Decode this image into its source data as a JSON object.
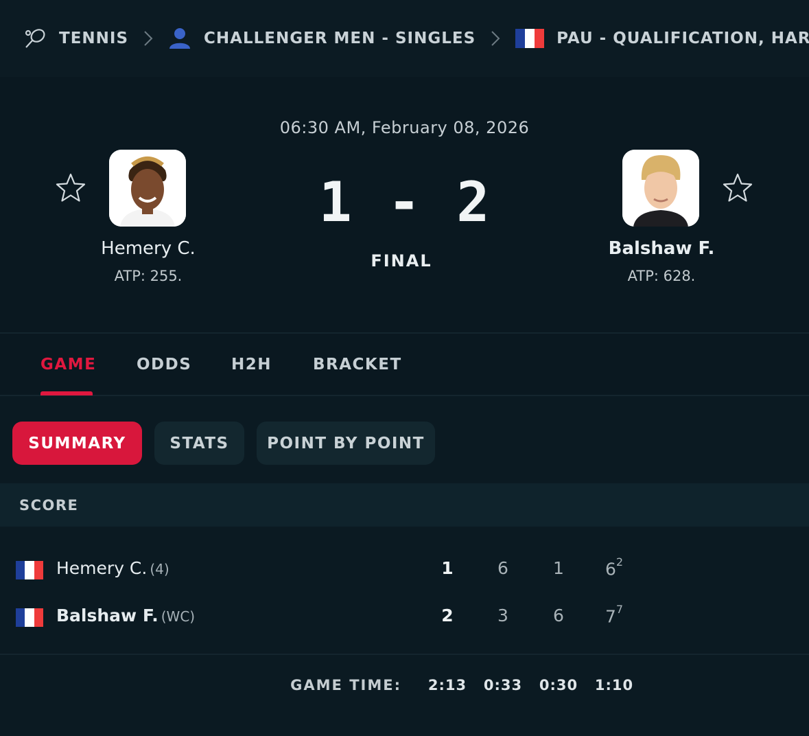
{
  "breadcrumb": {
    "sport": "TENNIS",
    "category": "CHALLENGER MEN - SINGLES",
    "tournament": "PAU - QUALIFICATION, HARD -"
  },
  "match": {
    "datetime": "06:30 AM, February 08, 2026",
    "score": "1-2",
    "status": "FINAL",
    "home": {
      "name": "Hemery C.",
      "rank": "ATP: 255."
    },
    "away": {
      "name": "Balshaw F.",
      "rank": "ATP: 628."
    }
  },
  "tabs": [
    "GAME",
    "ODDS",
    "H2H",
    "BRACKET"
  ],
  "subtabs": [
    "SUMMARY",
    "STATS",
    "POINT BY POINT"
  ],
  "score_table": {
    "header": "SCORE",
    "rows": [
      {
        "name": "Hemery C.",
        "seed": "(4)",
        "sets": "1",
        "s1": "6",
        "s2": "1",
        "s3": "6",
        "s3_tb": "2"
      },
      {
        "name": "Balshaw F.",
        "seed": "(WC)",
        "sets": "2",
        "s1": "3",
        "s2": "6",
        "s3": "7",
        "s3_tb": "7"
      }
    ],
    "game_time_label": "GAME TIME:",
    "game_time": [
      "2:13",
      "0:33",
      "0:30",
      "1:10"
    ]
  },
  "colors": {
    "accent": "#e0183f",
    "background": "#0b1a22",
    "flag_blue": "#1f3f9a",
    "flag_white": "#ffffff",
    "flag_red": "#ef3b3b"
  },
  "icons": [
    "tennis-racket-icon",
    "chevron-right-icon",
    "person-icon",
    "france-flag-icon",
    "star-outline-icon"
  ]
}
